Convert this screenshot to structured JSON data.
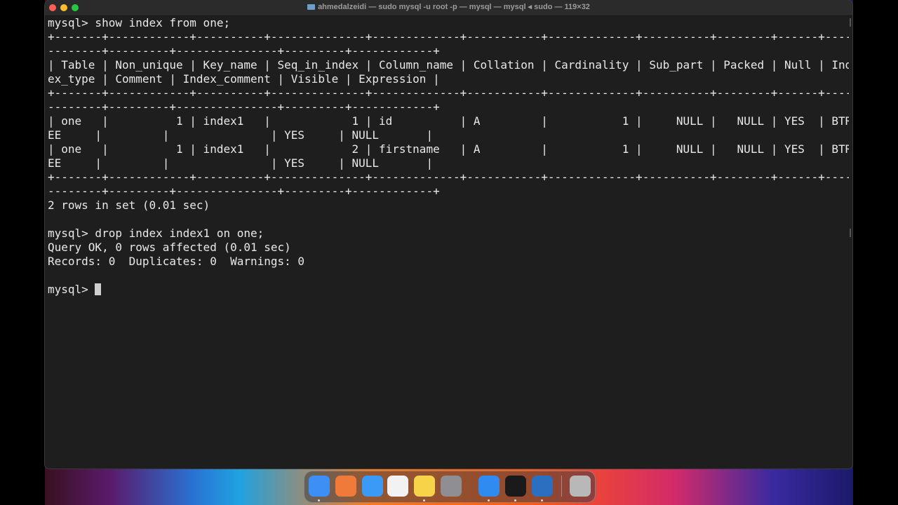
{
  "window": {
    "title": "ahmedalzeidi — sudo mysql -u root -p — mysql — mysql ◂ sudo — 119×32"
  },
  "terminal": {
    "lines": [
      "mysql> show index from one;",
      "+-------+------------+----------+--------------+-------------+-----------+-------------+----------+--------+------+----",
      "--------+---------+---------------+---------+------------+",
      "| Table | Non_unique | Key_name | Seq_in_index | Column_name | Collation | Cardinality | Sub_part | Packed | Null | Ind",
      "ex_type | Comment | Index_comment | Visible | Expression |",
      "+-------+------------+----------+--------------+-------------+-----------+-------------+----------+--------+------+----",
      "--------+---------+---------------+---------+------------+",
      "| one   |          1 | index1   |            1 | id          | A         |           1 |     NULL |   NULL | YES  | BTR",
      "EE     |         |               | YES     | NULL       |",
      "| one   |          1 | index1   |            2 | firstname   | A         |           1 |     NULL |   NULL | YES  | BTR",
      "EE     |         |               | YES     | NULL       |",
      "+-------+------------+----------+--------------+-------------+-----------+-------------+----------+--------+------+----",
      "--------+---------+---------------+---------+------------+",
      "2 rows in set (0.01 sec)",
      "",
      "mysql> drop index index1 on one;",
      "Query OK, 0 rows affected (0.01 sec)",
      "Records: 0  Duplicates: 0  Warnings: 0",
      "",
      "mysql> "
    ]
  },
  "dock": {
    "items": [
      {
        "name": "finder-icon",
        "color": "#3d8ff5",
        "running": true
      },
      {
        "name": "launchpad-icon",
        "color": "#f07a3a",
        "running": false
      },
      {
        "name": "mail-icon",
        "color": "#3a9af5",
        "running": false
      },
      {
        "name": "photos-icon",
        "color": "#f2f2f2",
        "running": false
      },
      {
        "name": "notes-icon",
        "color": "#f7d34a",
        "running": true
      },
      {
        "name": "system-settings-icon",
        "color": "#8e8e93",
        "running": false
      },
      {
        "name": "safari-icon",
        "color": "#2f8bf0",
        "running": true
      },
      {
        "name": "terminal-icon",
        "color": "#1a1a1a",
        "running": true
      },
      {
        "name": "quicktime-icon",
        "color": "#2a6fc0",
        "running": true
      },
      {
        "name": "trash-icon",
        "color": "#b8b8b8",
        "running": false
      }
    ]
  },
  "colors": {
    "terminal_bg": "#1e1e1e",
    "terminal_fg": "#e9e9e9"
  }
}
